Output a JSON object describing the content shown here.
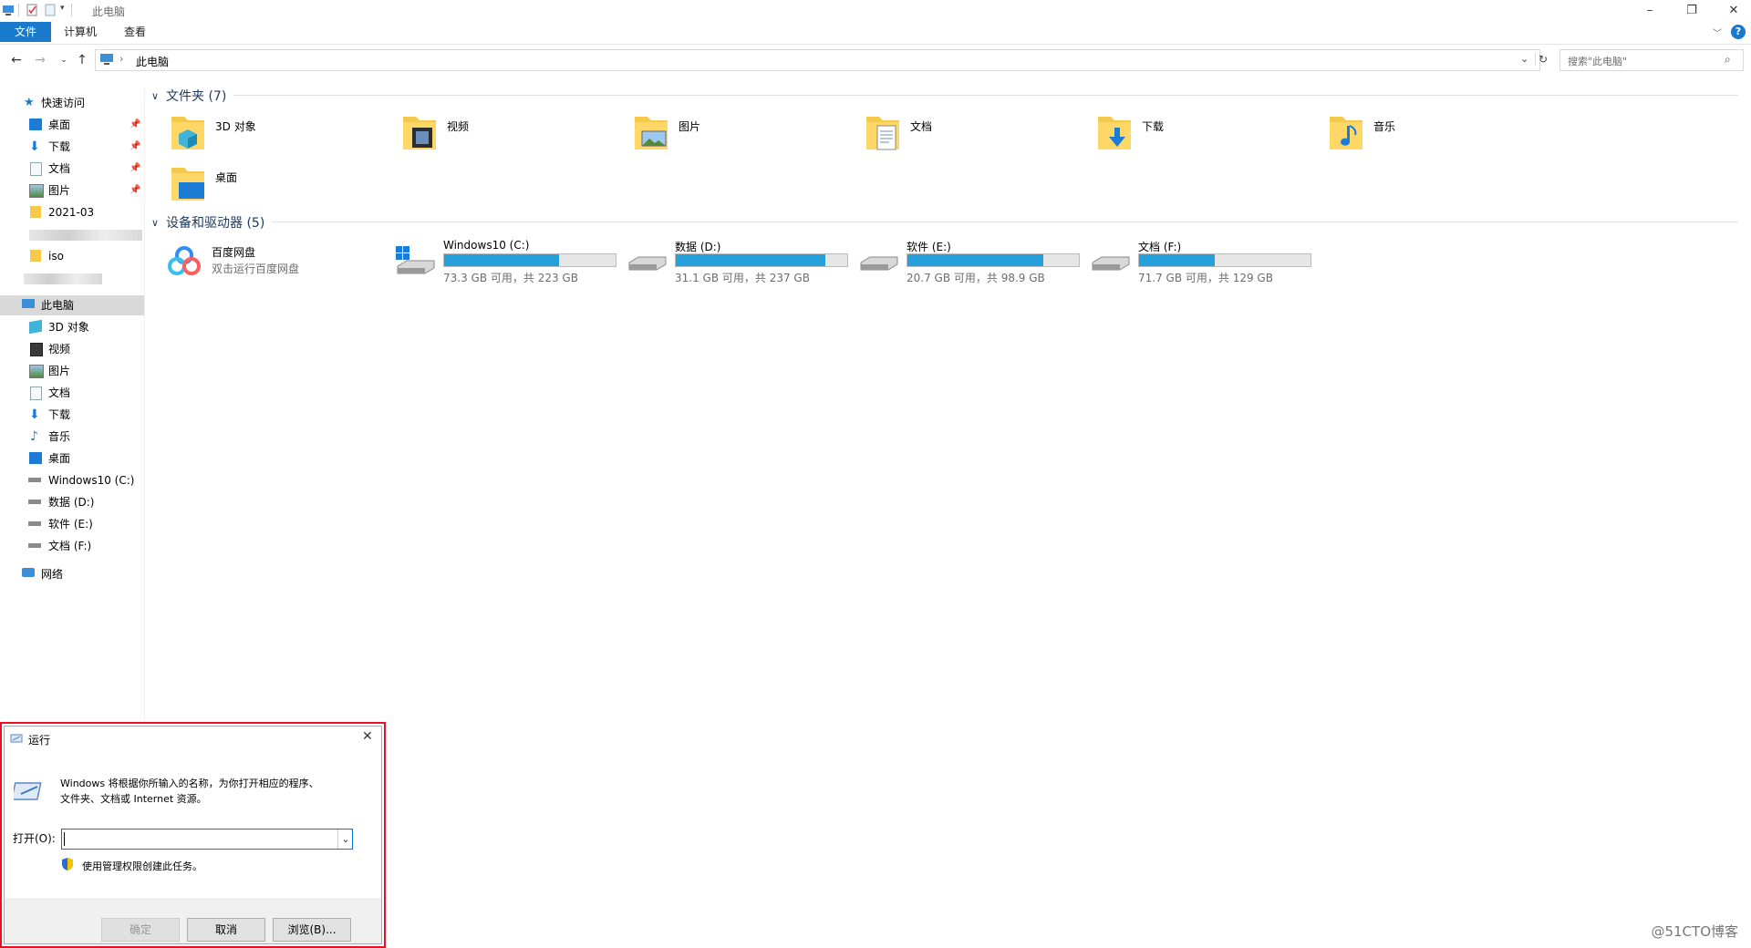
{
  "window": {
    "title": "此电脑"
  },
  "ribbon": {
    "tabs": [
      "文件",
      "计算机",
      "查看"
    ]
  },
  "address": {
    "path": "此电脑"
  },
  "search": {
    "placeholder": "搜索\"此电脑\""
  },
  "sidebar": {
    "quick_access": "快速访问",
    "quick_items": [
      "桌面",
      "下载",
      "文档",
      "图片",
      "2021-03",
      "iso"
    ],
    "this_pc": "此电脑",
    "pc_items": [
      "3D 对象",
      "视频",
      "图片",
      "文档",
      "下载",
      "音乐",
      "桌面",
      "Windows10 (C:)",
      "数据 (D:)",
      "软件 (E:)",
      "文档 (F:)"
    ],
    "network": "网络"
  },
  "folders": {
    "group_title": "文件夹 (7)",
    "items": [
      "3D 对象",
      "视频",
      "图片",
      "文档",
      "下载",
      "音乐",
      "桌面"
    ]
  },
  "devices": {
    "group_title": "设备和驱动器 (5)",
    "baidu": {
      "name": "百度网盘",
      "sub": "双击运行百度网盘"
    },
    "drives": [
      {
        "name": "Windows10 (C:)",
        "free": "73.3 GB 可用，共 223 GB",
        "used_fraction": 0.67
      },
      {
        "name": "数据 (D:)",
        "free": "31.1 GB 可用，共 237 GB",
        "used_fraction": 0.87
      },
      {
        "name": "软件 (E:)",
        "free": "20.7 GB 可用，共 98.9 GB",
        "used_fraction": 0.79
      },
      {
        "name": "文档 (F:)",
        "free": "71.7 GB 可用，共 129 GB",
        "used_fraction": 0.44
      }
    ]
  },
  "run_dialog": {
    "title": "运行",
    "description_line1": "Windows 将根据你所输入的名称，为你打开相应的程序、",
    "description_line2": "文件夹、文档或 Internet 资源。",
    "open_label": "打开(O):",
    "open_value": "",
    "admin_note": "使用管理权限创建此任务。",
    "ok": "确定",
    "cancel": "取消",
    "browse": "浏览(B)..."
  },
  "watermark": "@51CTO博客",
  "colors": {
    "accent": "#1979ca",
    "drive_bar": "#26a0da",
    "highlight_border": "#e81123"
  }
}
